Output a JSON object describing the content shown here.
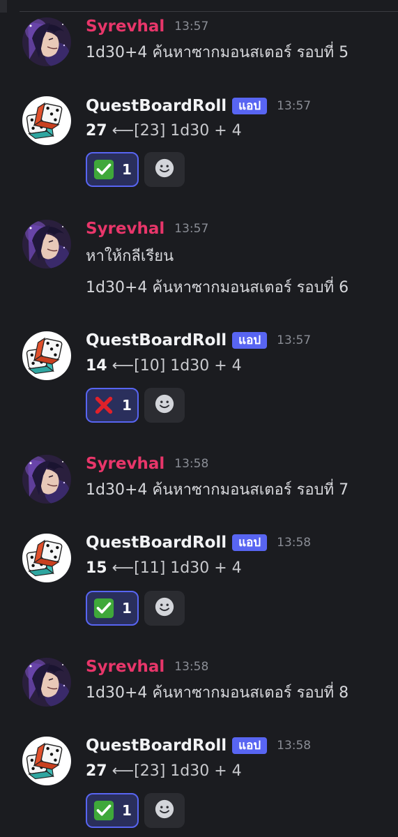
{
  "colors": {
    "background": "#1b1c20",
    "user_name": "#e8366a",
    "bot_name": "#f2f3f5",
    "app_tag": "#5865f2",
    "timestamp": "#8a8d95",
    "reaction_bg": "#2a2f5c",
    "reaction_border": "#5865f2"
  },
  "messages": [
    {
      "author": "Syrevhal",
      "time": "13:57",
      "avatar_icon": "user-avatar-icon",
      "lines": [
        "1d30+4 ค้นหาซากมอนสเตอร์ รอบที่ 5"
      ]
    },
    {
      "author": "QuestBoardRoll",
      "app_tag": "แอป",
      "time": "13:57",
      "avatar_icon": "dice-avatar-icon",
      "result": "27",
      "detail": " ⟵[23] 1d30 + 4",
      "reaction": {
        "emoji": "check-mark-icon",
        "count": "1"
      }
    },
    {
      "author": "Syrevhal",
      "time": "13:57",
      "avatar_icon": "user-avatar-icon",
      "lines": [
        "หาให้กลีเรียน",
        "1d30+4 ค้นหาซากมอนสเตอร์ รอบที่ 6"
      ]
    },
    {
      "author": "QuestBoardRoll",
      "app_tag": "แอป",
      "time": "13:57",
      "avatar_icon": "dice-avatar-icon",
      "result": "14",
      "detail": " ⟵[10] 1d30 + 4",
      "reaction": {
        "emoji": "cross-mark-icon",
        "count": "1"
      }
    },
    {
      "author": "Syrevhal",
      "time": "13:58",
      "avatar_icon": "user-avatar-icon",
      "lines": [
        "1d30+4 ค้นหาซากมอนสเตอร์ รอบที่ 7"
      ]
    },
    {
      "author": "QuestBoardRoll",
      "app_tag": "แอป",
      "time": "13:58",
      "avatar_icon": "dice-avatar-icon",
      "result": "15",
      "detail": " ⟵[11] 1d30 + 4",
      "reaction": {
        "emoji": "check-mark-icon",
        "count": "1"
      }
    },
    {
      "author": "Syrevhal",
      "time": "13:58",
      "avatar_icon": "user-avatar-icon",
      "lines": [
        "1d30+4 ค้นหาซากมอนสเตอร์ รอบที่ 8"
      ]
    },
    {
      "author": "QuestBoardRoll",
      "app_tag": "แอป",
      "time": "13:58",
      "avatar_icon": "dice-avatar-icon",
      "result": "27",
      "detail": " ⟵[23] 1d30 + 4",
      "reaction": {
        "emoji": "check-mark-icon",
        "count": "1"
      }
    }
  ]
}
